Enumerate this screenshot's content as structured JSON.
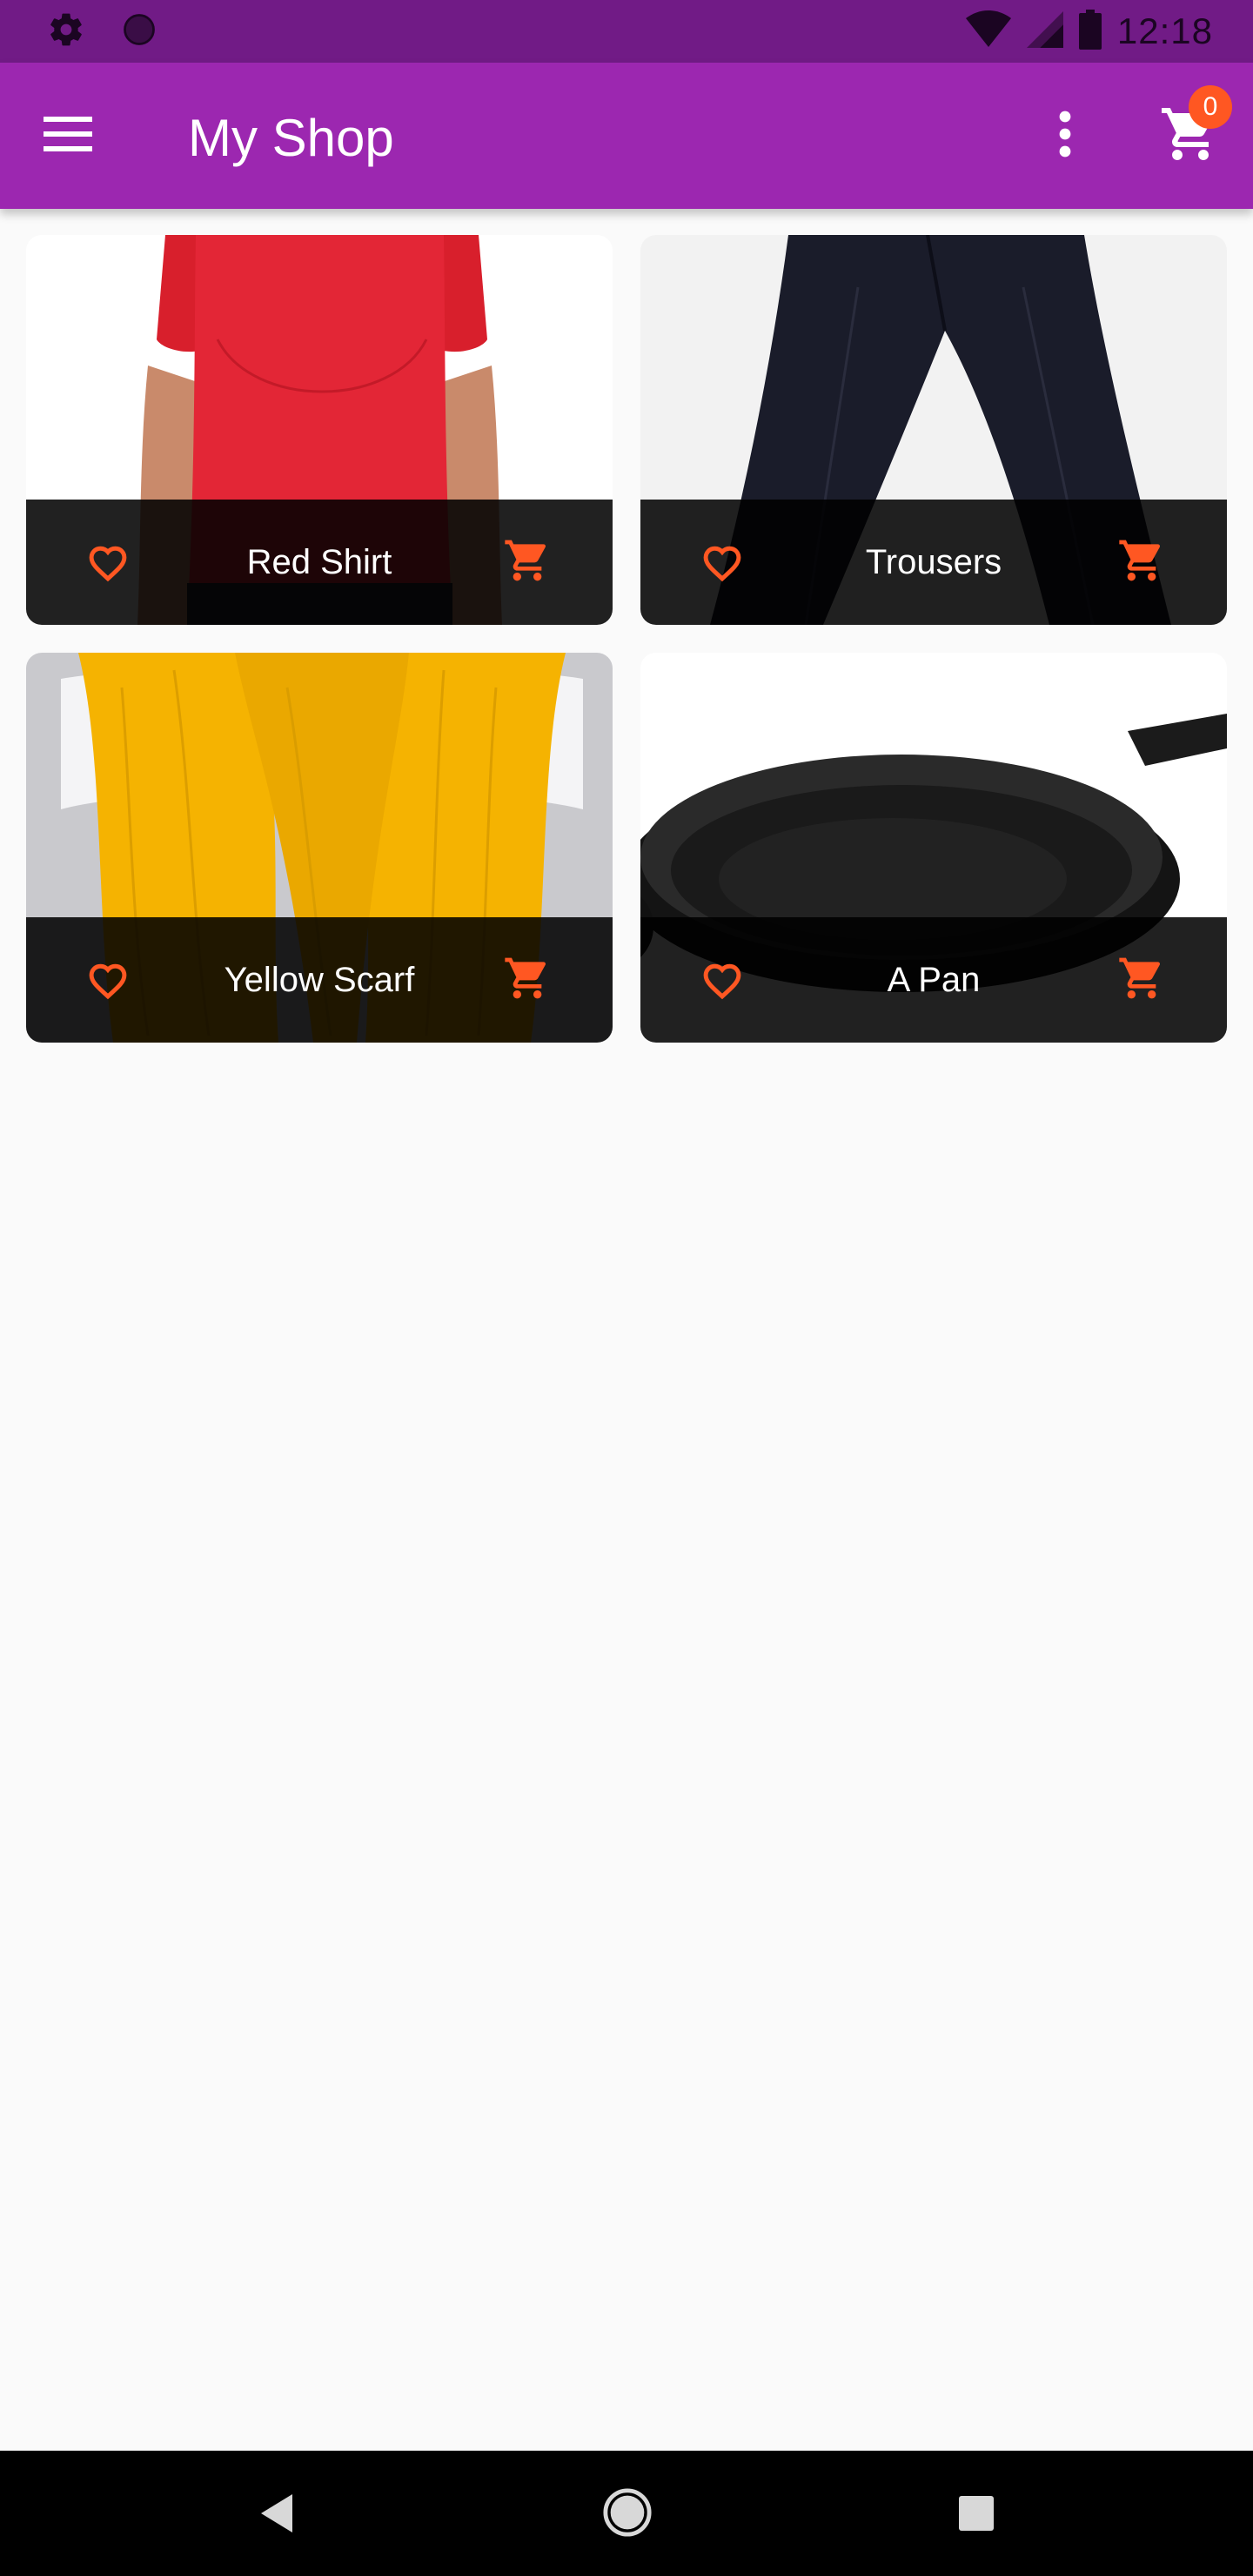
{
  "status_bar": {
    "time": "12:18",
    "icons": [
      "settings-icon",
      "circle-icon",
      "wifi-icon",
      "signal-icon",
      "battery-icon"
    ]
  },
  "app_bar": {
    "title": "My Shop",
    "cart_count": "0",
    "icons": [
      "menu-icon",
      "more-vert-icon",
      "shopping-cart-icon"
    ]
  },
  "products": [
    {
      "title": "Red Shirt",
      "image": "red-shirt-photo"
    },
    {
      "title": "Trousers",
      "image": "trousers-photo"
    },
    {
      "title": "Yellow Scarf",
      "image": "yellow-scarf-photo"
    },
    {
      "title": "A Pan",
      "image": "pan-photo"
    }
  ],
  "nav_bar": {
    "icons": [
      "back-icon",
      "home-icon",
      "recents-icon"
    ]
  },
  "colors": {
    "status_bar": "#711b86",
    "app_bar": "#9c27b0",
    "accent": "#ff5722",
    "background": "#fafafa",
    "footer": "#000000"
  }
}
